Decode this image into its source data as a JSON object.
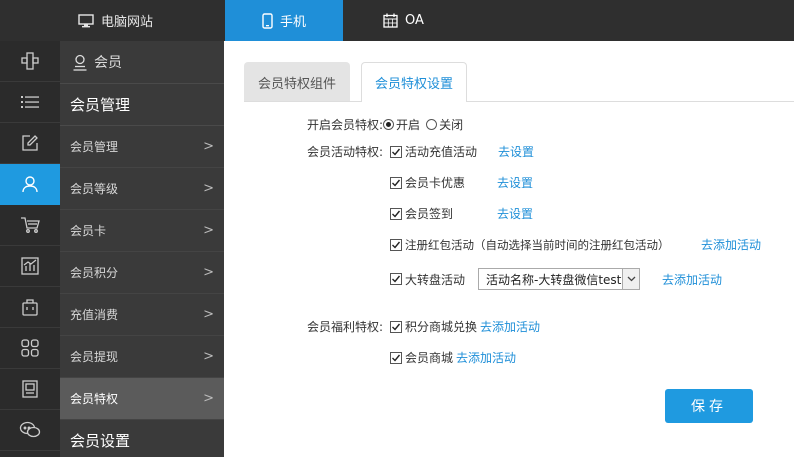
{
  "topbar": {
    "tabs": [
      {
        "label": "电脑网站",
        "icon": "monitor-icon"
      },
      {
        "label": "手机",
        "icon": "phone-icon"
      },
      {
        "label": "OA",
        "icon": "calendar-icon"
      }
    ],
    "accent": "#1f8fd8"
  },
  "sidebar": {
    "head": "会员",
    "title": "会员管理",
    "items": [
      {
        "label": "会员管理"
      },
      {
        "label": "会员等级"
      },
      {
        "label": "会员卡"
      },
      {
        "label": "会员积分"
      },
      {
        "label": "充值消费"
      },
      {
        "label": "会员提现"
      },
      {
        "label": "会员特权"
      }
    ],
    "foot": "会员设置",
    "arrow": ">"
  },
  "content": {
    "tabs": [
      "会员特权组件",
      "会员特权设置"
    ],
    "enable": {
      "label": "开启会员特权:",
      "on": "开启",
      "off": "关闭"
    },
    "activity": {
      "label": "会员活动特权:",
      "items": [
        {
          "name": "活动充值活动",
          "link": "去设置"
        },
        {
          "name": "会员卡优惠",
          "link": "去设置"
        },
        {
          "name": "会员签到",
          "link": "去设置"
        },
        {
          "name": "注册红包活动（自动选择当前时间的注册红包活动）",
          "link": "去添加活动"
        },
        {
          "name": "大转盘活动",
          "link": "去添加活动"
        }
      ],
      "wheel_select": "活动名称-大转盘微信test"
    },
    "welfare": {
      "label": "会员福利特权:",
      "items": [
        {
          "name": "积分商城兑换",
          "link": "去添加活动"
        },
        {
          "name": "会员商城",
          "link": "去添加活动"
        }
      ]
    },
    "save": "保存"
  }
}
